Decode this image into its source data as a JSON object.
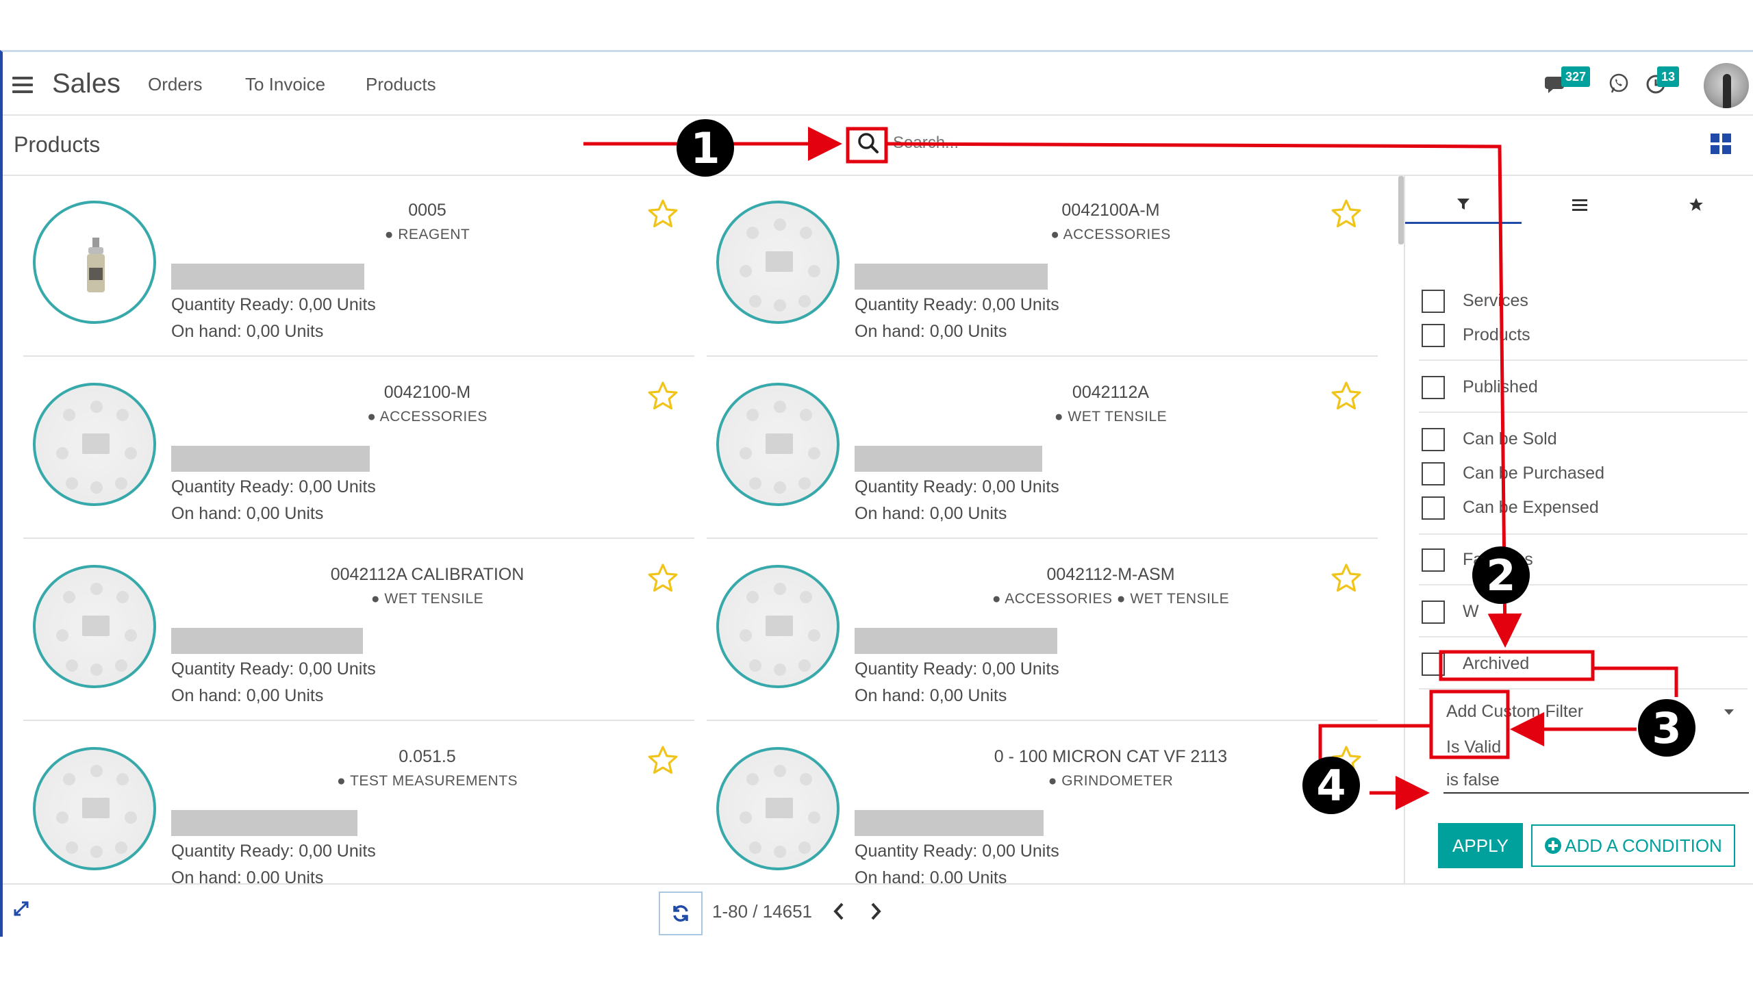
{
  "navbar": {
    "app_name": "Sales",
    "menu": [
      "Orders",
      "To Invoice",
      "Products"
    ],
    "chat_badge": "327",
    "activity_badge": "13"
  },
  "control_panel": {
    "title": "Products",
    "search_placeholder": "Search..."
  },
  "products": [
    {
      "code": "0005",
      "category": "● REAGENT",
      "qty": "Quantity Ready: 0,00 Units",
      "onhand": "On hand: 0,00 Units",
      "image": "bottle"
    },
    {
      "code": "0042100A-M",
      "category": "● ACCESSORIES",
      "qty": "Quantity Ready: 0,00 Units",
      "onhand": "On hand: 0,00 Units",
      "image": "placeholder"
    },
    {
      "code": "0042100-M",
      "category": "● ACCESSORIES",
      "qty": "Quantity Ready: 0,00 Units",
      "onhand": "On hand: 0,00 Units",
      "image": "placeholder"
    },
    {
      "code": "0042112A",
      "category": "● WET TENSILE",
      "qty": "Quantity Ready: 0,00 Units",
      "onhand": "On hand: 0,00 Units",
      "image": "placeholder"
    },
    {
      "code": "0042112A CALIBRATION",
      "category": "● WET TENSILE",
      "qty": "Quantity Ready: 0,00 Units",
      "onhand": "On hand: 0,00 Units",
      "image": "placeholder"
    },
    {
      "code": "0042112-M-ASM",
      "category": "● ACCESSORIES ● WET TENSILE",
      "qty": "Quantity Ready: 0,00 Units",
      "onhand": "On hand: 0,00 Units",
      "image": "placeholder"
    },
    {
      "code": "0.051.5",
      "category": "● TEST MEASUREMENTS",
      "qty": "Quantity Ready: 0,00 Units",
      "onhand": "On hand: 0.00 Units",
      "image": "placeholder"
    },
    {
      "code": "0 - 100 MICRON CAT VF 2113",
      "category": "● GRINDOMETER",
      "qty": "Quantity Ready: 0,00 Units",
      "onhand": "On hand: 0.00 Units",
      "image": "placeholder"
    }
  ],
  "filter_panel": {
    "tabs": [
      "filter-icon",
      "group-by-icon",
      "favorites-star-icon"
    ],
    "filters": [
      "Services",
      "Products",
      "Published",
      "Can be Sold",
      "Can be Purchased",
      "Can be Expensed",
      "Favorites",
      "W",
      "Archived"
    ],
    "add_custom_filter": "Add Custom Filter",
    "field_value": "Is Valid",
    "operator_value": "is false",
    "apply_label": "APPLY",
    "add_condition_label": "ADD A CONDITION"
  },
  "pager": {
    "value": "1-80 / 14651"
  },
  "annotations": {
    "steps": [
      "1",
      "2",
      "3",
      "4"
    ],
    "arrow_color": "#e3000f"
  },
  "colors": {
    "primary": "#00a09d",
    "accent_blue": "#1f4aa8",
    "star": "#f0c419",
    "thumb_ring": "#37a9ab"
  }
}
